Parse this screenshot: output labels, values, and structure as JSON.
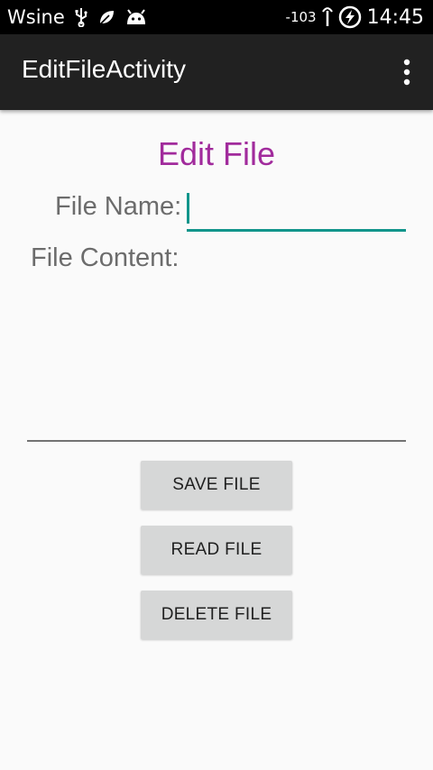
{
  "status_bar": {
    "carrier": "Wsine",
    "signal_text": "-103",
    "time": "14:45",
    "icons": [
      "usb-icon",
      "leaf-icon",
      "android-debug-icon",
      "wifi-icon",
      "battery-charging-icon"
    ]
  },
  "app_bar": {
    "title": "EditFileActivity",
    "overflow_icon": "more-vert-icon"
  },
  "form": {
    "heading": "Edit File",
    "file_name_label": "File Name:",
    "file_name_value": "",
    "file_content_label": "File Content:",
    "file_content_value": ""
  },
  "buttons": {
    "save": "SAVE FILE",
    "read": "READ FILE",
    "delete": "DELETE FILE"
  },
  "colors": {
    "accent": "#12958b",
    "heading": "#a12b9c",
    "app_bar": "#212121",
    "button": "#d6d7d7"
  }
}
